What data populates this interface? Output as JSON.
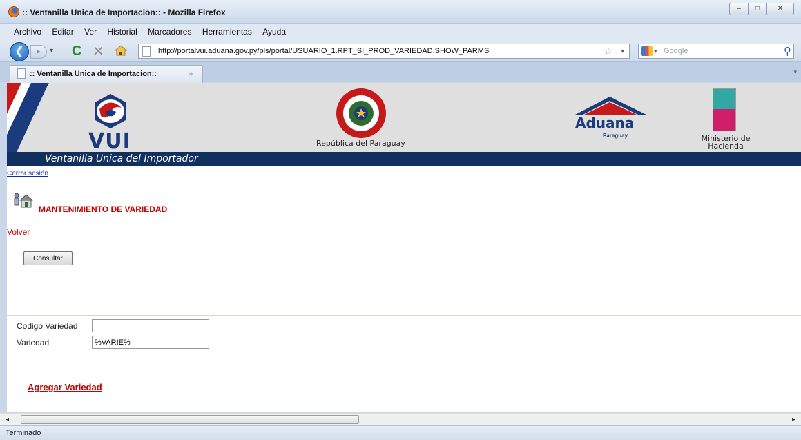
{
  "window": {
    "title": ":: Ventanilla Unica de Importacion:: - Mozilla Firefox",
    "controls": {
      "minimize": "–",
      "maximize": "□",
      "close": "✕"
    }
  },
  "menu": [
    "Archivo",
    "Editar",
    "Ver",
    "Historial",
    "Marcadores",
    "Herramientas",
    "Ayuda"
  ],
  "nav": {
    "back_glyph": "❮",
    "fwd_glyph": "▸",
    "url": "http://portalvui.aduana.gov.py/pls/portal/USUARIO_1.RPT_SI_PROD_VARIEDAD.SHOW_PARMS",
    "search_placeholder": "Google"
  },
  "tab": {
    "label": ":: Ventanilla Unica de Importacion::"
  },
  "banner": {
    "vui": "VUI",
    "republica": "República del Paraguay",
    "aduana": "Aduana",
    "aduana_sub": "Paraguay",
    "ministerio_line1": "Ministerio de",
    "ministerio_line2": "Hacienda",
    "bar_text": "Ventanilla Unica del Importador"
  },
  "page": {
    "logout": "Cerrar sesión",
    "title": "MANTENIMIENTO DE VARIEDAD",
    "back_link": "Volver",
    "consult_button": "Consultar",
    "form": {
      "codigo_label": "Codigo Variedad",
      "codigo_value": "",
      "variedad_label": "Variedad",
      "variedad_value": "%VARIE%"
    },
    "add_link": "Agregar Variedad"
  },
  "status": "Terminado",
  "colors": {
    "accent_red": "#c40000",
    "navy": "#12305f",
    "link_blue": "#0a2db7"
  }
}
